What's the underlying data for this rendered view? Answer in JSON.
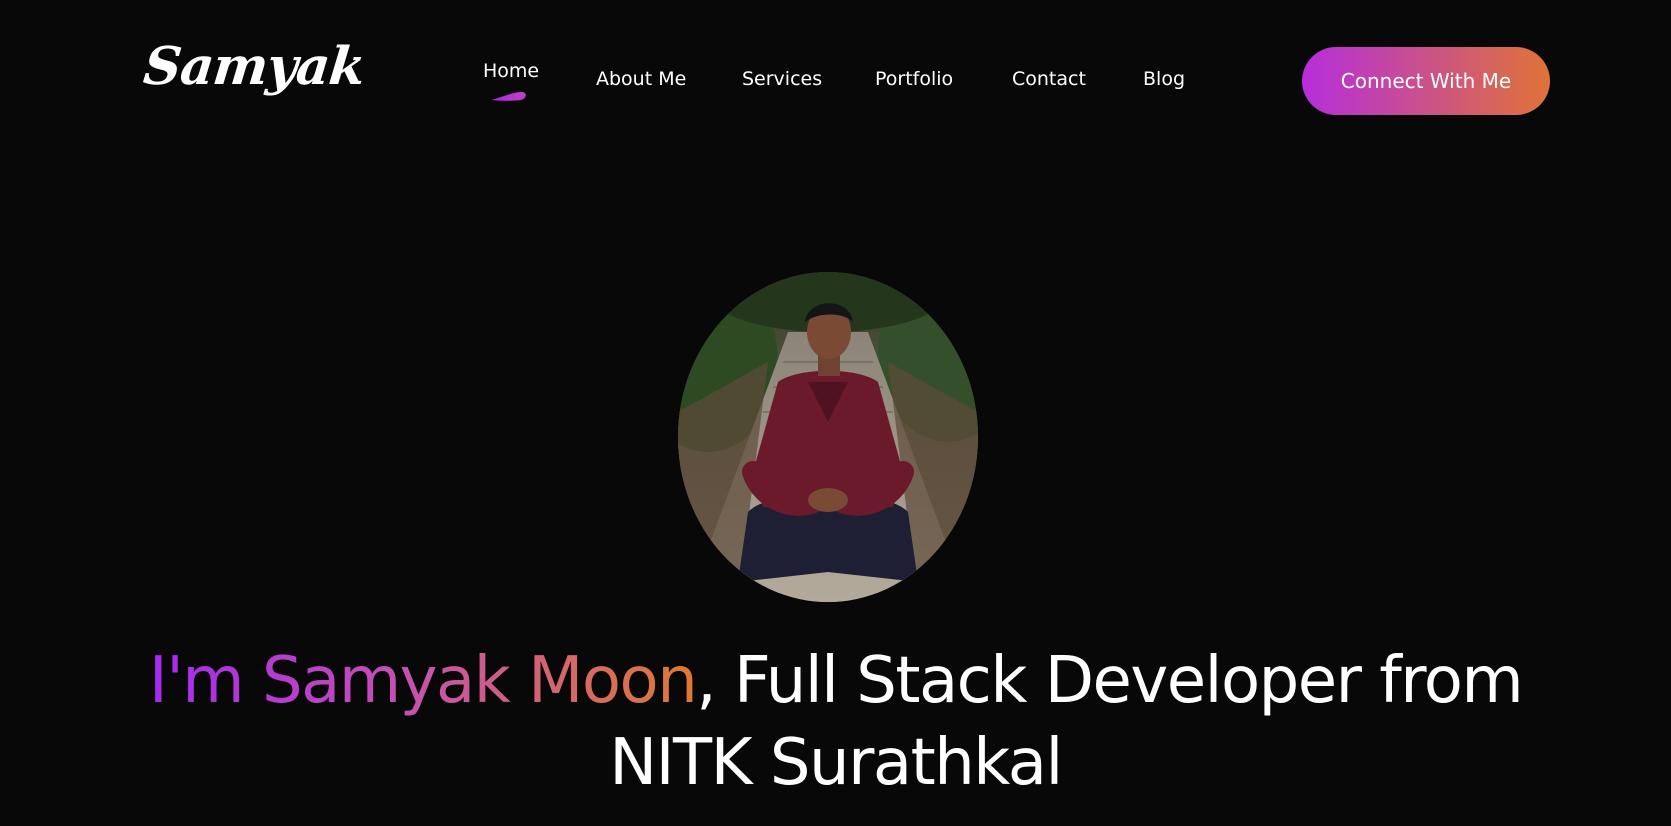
{
  "brand": {
    "logo_text": "Samyak"
  },
  "nav": {
    "items": [
      {
        "label": "Home",
        "active": true
      },
      {
        "label": "About Me",
        "active": false
      },
      {
        "label": "Services",
        "active": false
      },
      {
        "label": "Portfolio",
        "active": false
      },
      {
        "label": "Contact",
        "active": false
      },
      {
        "label": "Blog",
        "active": false
      }
    ],
    "cta_label": "Connect With Me"
  },
  "hero": {
    "name_prefix": "I'm Samyak Moon",
    "title_rest": ", Full Stack Developer from",
    "title_line2": "NITK Surathkal"
  },
  "colors": {
    "background": "#080808",
    "accent_purple": "#b62edc",
    "accent_orange": "#df7437",
    "text": "#ffffff"
  },
  "icons": {
    "active_indicator": "brush-stroke-underline"
  }
}
